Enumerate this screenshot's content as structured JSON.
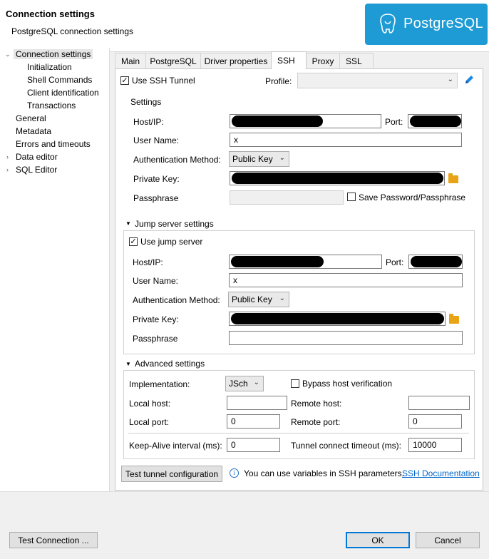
{
  "header": {
    "title": "Connection settings",
    "subtitle": "PostgreSQL connection settings",
    "logo_text": "PostgreSQL"
  },
  "sidebar": {
    "items": [
      {
        "label": "Connection settings"
      },
      {
        "label": "Initialization"
      },
      {
        "label": "Shell Commands"
      },
      {
        "label": "Client identification"
      },
      {
        "label": "Transactions"
      },
      {
        "label": "General"
      },
      {
        "label": "Metadata"
      },
      {
        "label": "Errors and timeouts"
      },
      {
        "label": "Data editor"
      },
      {
        "label": "SQL Editor"
      }
    ]
  },
  "tabs": [
    {
      "label": "Main"
    },
    {
      "label": "PostgreSQL"
    },
    {
      "label": "Driver properties"
    },
    {
      "label": "SSH"
    },
    {
      "label": "Proxy"
    },
    {
      "label": "SSL"
    }
  ],
  "ssh": {
    "use_tunnel_label": "Use SSH Tunnel",
    "profile_label": "Profile:",
    "profile_value": "",
    "settings": {
      "title": "Settings",
      "host_label": "Host/IP:",
      "port_label": "Port:",
      "user_label": "User Name:",
      "user_value": "x",
      "auth_label": "Authentication Method:",
      "auth_value": "Public Key",
      "key_label": "Private Key:",
      "pass_label": "Passphrase",
      "save_pass_label": "Save Password/Passphrase"
    },
    "jump": {
      "title": "Jump server settings",
      "use_label": "Use jump server",
      "host_label": "Host/IP:",
      "port_label": "Port:",
      "user_label": "User Name:",
      "user_value": "x",
      "auth_label": "Authentication Method:",
      "auth_value": "Public Key",
      "key_label": "Private Key:",
      "pass_label": "Passphrase"
    },
    "advanced": {
      "title": "Advanced settings",
      "impl_label": "Implementation:",
      "impl_value": "JSch",
      "bypass_label": "Bypass host verification",
      "local_host_label": "Local host:",
      "remote_host_label": "Remote host:",
      "local_port_label": "Local port:",
      "local_port_value": "0",
      "remote_port_label": "Remote port:",
      "remote_port_value": "0",
      "keepalive_label": "Keep-Alive interval (ms):",
      "keepalive_value": "0",
      "timeout_label": "Tunnel connect timeout (ms):",
      "timeout_value": "10000"
    },
    "test_tunnel_label": "Test tunnel configuration",
    "info_text": "You can use variables in SSH parameters.",
    "doc_link": "SSH Documentation"
  },
  "footer": {
    "test_connection": "Test Connection ...",
    "ok": "OK",
    "cancel": "Cancel"
  },
  "colors": {
    "accent": "#1e9bd4",
    "link": "#0066cc",
    "folder": "#e8a317"
  }
}
